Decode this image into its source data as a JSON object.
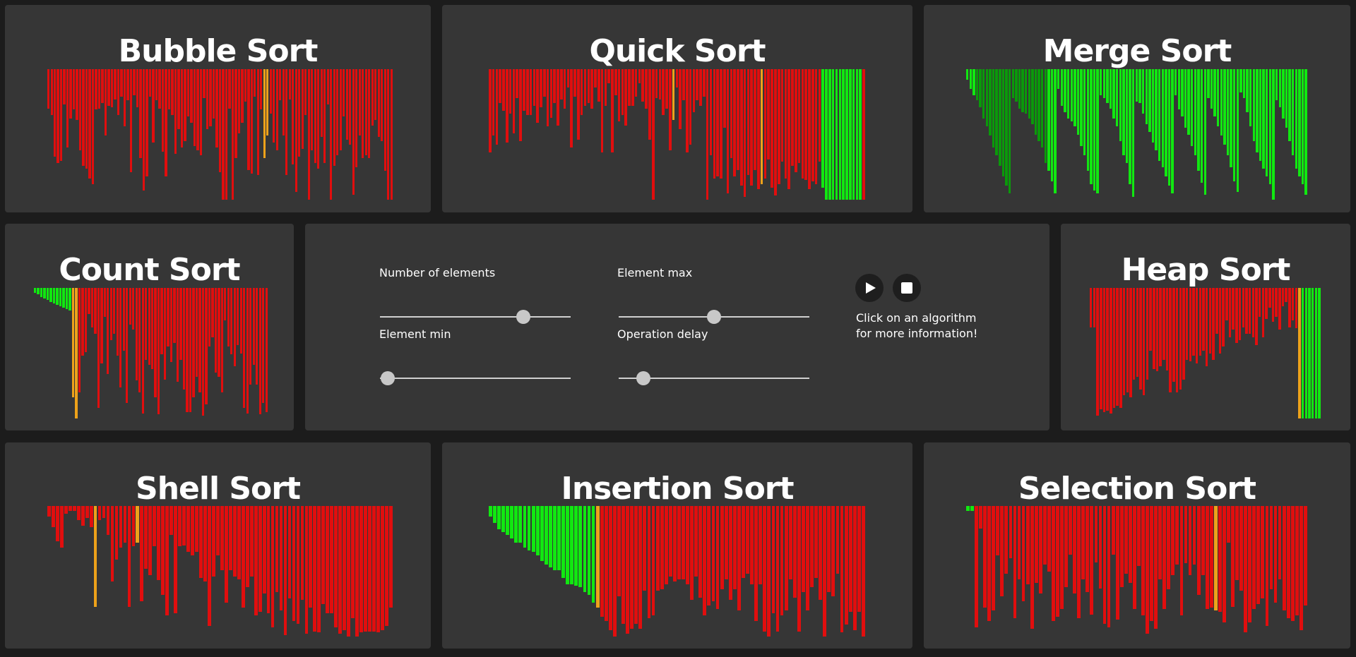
{
  "colors": {
    "background": "#1c1c1c",
    "panel": "#363636",
    "unsorted": "#e10e0e",
    "sorted": "#11e811",
    "sorted_dark": "#0a9a0a",
    "compare": "#eea21a"
  },
  "controls": {
    "num_elements_label": "Number of elements",
    "element_max_label": "Element max",
    "element_min_label": "Element min",
    "operation_delay_label": "Operation delay",
    "num_elements_level": 0.75,
    "element_max_level": 0.5,
    "element_min_level": 0.04,
    "operation_delay_level": 0.13,
    "play_icon": "play-icon",
    "stop_icon": "stop-icon",
    "hint_line1": "Click on an algorithm",
    "hint_line2": "for more information!"
  },
  "algorithms": [
    {
      "key": "bubble",
      "title": "Bubble Sort",
      "bars": [
        30,
        35,
        67,
        72,
        70,
        27,
        60,
        38,
        31,
        39,
        62,
        74,
        76,
        84,
        88,
        31,
        30,
        26,
        51,
        28,
        29,
        23,
        35,
        21,
        44,
        24,
        79,
        20,
        29,
        68,
        93,
        82,
        21,
        56,
        24,
        30,
        63,
        82,
        31,
        35,
        65,
        46,
        60,
        55,
        36,
        41,
        59,
        62,
        66,
        22,
        46,
        44,
        38,
        60,
        79,
        100,
        100,
        30,
        100,
        68,
        49,
        41,
        25,
        77,
        80,
        21,
        81,
        31,
        68,
        51,
        34,
        56,
        62,
        24,
        51,
        81,
        23,
        73,
        94,
        67,
        61,
        35,
        100,
        62,
        72,
        76,
        52,
        72,
        27,
        100,
        74,
        66,
        62,
        36,
        54,
        58,
        96,
        75,
        51,
        68,
        66,
        68,
        43,
        39,
        52,
        55,
        78,
        100,
        100
      ],
      "states": "uuuuuuuuuuuuuuuuuuuuuuuuuuuuuuuuuuuuuuuuuuuuuuuuuuuuuuuuuuuuuuuuuuuuccuuuuuuuuuuuuuuuuuuuuuuuuuuuuuuuuuuuuuuuuuuuuuuuuuuuuuuuuuuuuuuuuuuuuuuuuuuuuuuuuuuuuuuuuuuuuuuuuuuuuuuuuuuuuuuuuuuuuuuuuuuuuuuuuuuuuuuuuuuuuuuuuuuuuuuuuuuuuuuuuuuuuuuuuuuuuuuuuuuuuuuuuuuuuuuuuuuuuuuuuuuuuuuuuuuuuuuuuuuuuuuuuuuus"
    },
    {
      "key": "quick",
      "title": "Quick Sort",
      "bars": [
        64,
        51,
        58,
        26,
        32,
        56,
        34,
        49,
        22,
        55,
        32,
        35,
        35,
        28,
        41,
        29,
        21,
        44,
        37,
        26,
        43,
        23,
        30,
        14,
        60,
        21,
        54,
        35,
        28,
        26,
        30,
        14,
        25,
        64,
        28,
        11,
        64,
        20,
        40,
        35,
        43,
        28,
        28,
        21,
        11,
        25,
        30,
        54,
        100,
        22,
        23,
        35,
        30,
        62,
        39,
        14,
        46,
        24,
        64,
        58,
        33,
        24,
        28,
        21,
        100,
        66,
        84,
        82,
        84,
        45,
        95,
        68,
        82,
        77,
        89,
        98,
        81,
        89,
        77,
        92,
        88,
        84,
        69,
        91,
        97,
        88,
        71,
        84,
        92,
        74,
        79,
        72,
        84,
        85,
        92,
        86,
        88,
        71,
        91,
        100,
        100,
        100,
        100,
        100,
        100,
        100,
        100,
        100,
        100,
        100,
        100
      ],
      "states": "uuuuuuuuuuuuuuuuuuuuuuuuuuuuuuuuuuuuuuuuuuuuuuuuuuuuuucuuuuuuuuuuuuuuuuuuuuuuuuucuuuuuuuuuuuuuuuuussssssssssss"
    },
    {
      "key": "merge",
      "title": "Merge Sort",
      "bars": [
        8,
        15,
        20,
        24,
        29,
        38,
        44,
        51,
        60,
        66,
        74,
        82,
        89,
        95,
        22,
        25,
        30,
        33,
        34,
        38,
        42,
        50,
        55,
        60,
        72,
        78,
        86,
        95,
        15,
        28,
        33,
        38,
        40,
        44,
        50,
        59,
        66,
        78,
        88,
        93,
        95,
        20,
        22,
        26,
        30,
        38,
        44,
        55,
        66,
        72,
        88,
        98,
        25,
        26,
        34,
        42,
        48,
        56,
        62,
        70,
        75,
        82,
        89,
        95,
        20,
        31,
        36,
        45,
        50,
        59,
        66,
        78,
        87,
        96,
        22,
        30,
        36,
        44,
        51,
        58,
        66,
        75,
        86,
        94,
        18,
        22,
        33,
        44,
        55,
        64,
        70,
        76,
        82,
        88,
        100,
        24,
        29,
        38,
        45,
        55,
        66,
        76,
        82,
        88,
        96
      ],
      "states": "sssddddddddddddddddddddddsssssssssssssssssssssssssssssssssssssssssssssssssssssssssssssssssssssssssssssssssssss"
    },
    {
      "key": "count",
      "title": "Count Sort",
      "bars": [
        4,
        5,
        7,
        8,
        9,
        11,
        12,
        13,
        14,
        15,
        16,
        17,
        84,
        100,
        80,
        52,
        49,
        20,
        30,
        35,
        92,
        58,
        22,
        66,
        40,
        35,
        52,
        76,
        48,
        88,
        28,
        32,
        71,
        80,
        96,
        55,
        59,
        62,
        84,
        97,
        51,
        70,
        45,
        57,
        42,
        72,
        55,
        78,
        95,
        95,
        84,
        68,
        80,
        98,
        89,
        45,
        38,
        65,
        68,
        80,
        25,
        45,
        51,
        60,
        44,
        50,
        92,
        96,
        74,
        59,
        74,
        97,
        88,
        95
      ],
      "states": "ssssssssssssccuuuuuuuuuuuuuuuuuuuuuuuuuuuuuuuuuuuuuuuuuuuuuuuuuuuuuuuuuuu"
    },
    {
      "key": "heap",
      "title": "Heap Sort",
      "bars": [
        30,
        30,
        98,
        93,
        95,
        94,
        96,
        92,
        90,
        92,
        82,
        80,
        84,
        70,
        68,
        78,
        82,
        70,
        48,
        62,
        64,
        60,
        55,
        63,
        80,
        72,
        80,
        78,
        70,
        55,
        56,
        52,
        58,
        52,
        48,
        60,
        50,
        55,
        35,
        50,
        45,
        25,
        38,
        32,
        42,
        40,
        30,
        35,
        35,
        38,
        44,
        22,
        38,
        24,
        15,
        26,
        22,
        32,
        14,
        11,
        30,
        25,
        31,
        100,
        100,
        100,
        100,
        100,
        100,
        100
      ],
      "states": "uuuuuuuuuuuuuuuuuuuuuuuuuuuuuuuuuuuuuuuuuuuuuuuuuuuuuuuuuuuuuuucssssss"
    },
    {
      "key": "shell",
      "title": "Shell Sort",
      "bars": [
        8,
        16,
        27,
        32,
        6,
        4,
        4,
        11,
        15,
        9,
        16,
        77,
        11,
        9,
        22,
        58,
        41,
        32,
        28,
        77,
        31,
        28,
        73,
        48,
        53,
        31,
        57,
        68,
        84,
        22,
        82,
        31,
        30,
        35,
        38,
        35,
        55,
        58,
        92,
        54,
        38,
        49,
        74,
        49,
        54,
        56,
        78,
        62,
        54,
        84,
        81,
        67,
        82,
        93,
        66,
        80,
        99,
        71,
        88,
        90,
        72,
        98,
        78,
        96,
        97,
        75,
        82,
        82,
        93,
        98,
        95,
        100,
        86,
        100,
        97,
        96,
        96,
        96,
        97,
        95,
        92,
        78
      ],
      "states": "uuuuuuuuuuucuuuuuuuuucuuuuuuuuuuuuuuuuuuuuuuuuuuuuuuuuuuuuuuuuuuuuuuuuuuuuuuuuuuuuuuuuuuuuuuuuu"
    },
    {
      "key": "insertion",
      "title": "Insertion Sort",
      "bars": [
        8,
        13,
        18,
        20,
        22,
        25,
        28,
        28,
        32,
        34,
        35,
        38,
        42,
        45,
        47,
        49,
        49,
        55,
        60,
        60,
        61,
        62,
        66,
        68,
        74,
        78,
        85,
        88,
        95,
        100,
        69,
        90,
        98,
        94,
        90,
        94,
        65,
        86,
        84,
        65,
        64,
        60,
        54,
        58,
        56,
        56,
        60,
        72,
        54,
        70,
        84,
        76,
        73,
        79,
        64,
        56,
        72,
        64,
        80,
        55,
        52,
        60,
        88,
        60,
        96,
        100,
        82,
        96,
        84,
        80,
        56,
        70,
        96,
        66,
        80,
        62,
        55,
        72,
        100,
        66,
        69,
        52,
        97,
        91,
        81,
        95,
        81,
        100
      ],
      "states": "ssssssssssssssssssssssssscuuuuuuuuuuuuuuuuuuuuuuuuuuuuuuuuuuuuuuuuuuuuuuuuuuuuuuuuuuuuuuuuuuuuuuuuuuu"
    },
    {
      "key": "selection",
      "title": "Selection Sort",
      "bars": [
        4,
        4,
        93,
        17,
        78,
        88,
        80,
        38,
        69,
        52,
        40,
        86,
        56,
        73,
        60,
        94,
        59,
        67,
        45,
        50,
        88,
        85,
        79,
        62,
        37,
        67,
        86,
        56,
        66,
        83,
        43,
        63,
        90,
        93,
        37,
        87,
        62,
        52,
        59,
        79,
        46,
        84,
        98,
        88,
        94,
        56,
        79,
        64,
        53,
        45,
        84,
        44,
        53,
        45,
        68,
        53,
        79,
        78,
        80,
        81,
        89,
        28,
        77,
        57,
        65,
        97,
        89,
        79,
        75,
        71,
        92,
        64,
        74,
        56,
        80,
        86,
        88,
        84,
        95,
        76
      ],
      "states": "ssuuuuuuuuuuuuuuuuuuuuuuuuuuuuuuuuuuuuuuuuuuuuuuuuuuuuuuuucuuuuuuuuuuuuuuuuuuuuuuuuuuuuuuuuuuuuuuuuuuuu"
    }
  ]
}
